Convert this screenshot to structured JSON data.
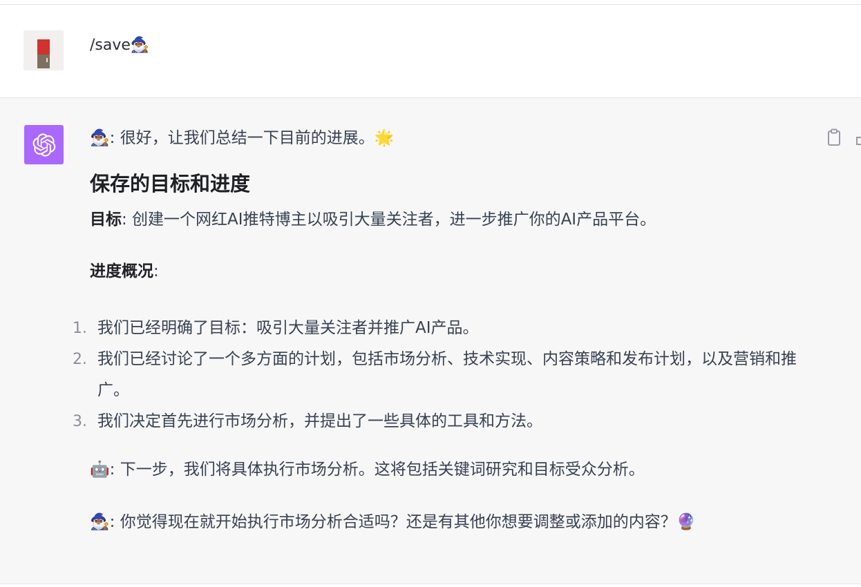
{
  "user_message": {
    "text": "/save🧙🏾‍♂️",
    "avatar": "user-avatar-icon"
  },
  "assistant_message": {
    "avatar": "openai-logo-icon",
    "intro": "🧙🏾‍♂️: 很好，让我们总结一下目前的进展。🌟",
    "heading": "保存的目标和进度",
    "goal_label": "目标",
    "goal_text": ": 创建一个网红AI推特博主以吸引大量关注者，进一步推广你的AI产品平台。",
    "progress_label": "进度概况",
    "progress_colon": ":",
    "steps": [
      {
        "num": "1.",
        "text": "我们已经明确了目标：吸引大量关注者并推广AI产品。"
      },
      {
        "num": "2.",
        "text": "我们已经讨论了一个多方面的计划，包括市场分析、技术实现、内容策略和发布计划，以及营销和推广。"
      },
      {
        "num": "3.",
        "text": "我们决定首先进行市场分析，并提出了一些具体的工具和方法。"
      }
    ],
    "next_step": "🤖: 下一步，我们将具体执行市场分析。这将包括关键词研究和目标受众分析。",
    "question": "🧙🏾‍♂️: 你觉得现在就开始执行市场分析合适吗？还是有其他你想要调整或添加的内容？🔮"
  },
  "actions": {
    "copy_icon": "clipboard-icon",
    "more_icon": "thumb-icon"
  },
  "colors": {
    "bot_avatar_bg": "#ab68ff",
    "assistant_bg": "#f7f7f8"
  }
}
